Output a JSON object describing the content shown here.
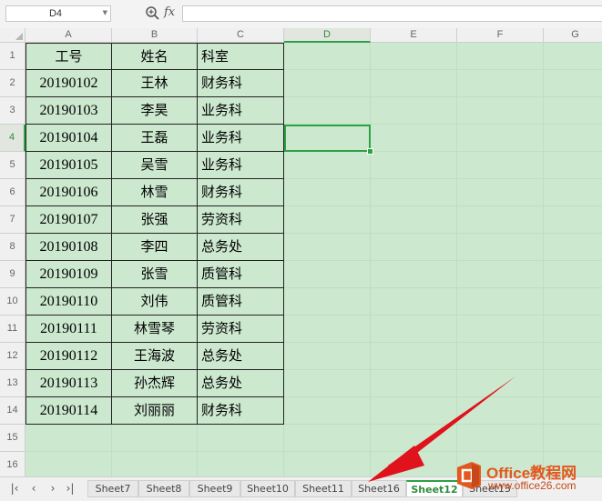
{
  "formula_bar": {
    "name_box": "D4",
    "fx_label": "fx",
    "formula": ""
  },
  "columns": [
    "A",
    "B",
    "C",
    "D",
    "E",
    "F",
    "G"
  ],
  "rows": [
    "1",
    "2",
    "3",
    "4",
    "5",
    "6",
    "7",
    "8",
    "9",
    "10",
    "11",
    "12",
    "13",
    "14",
    "15",
    "16"
  ],
  "selected_cell": "D4",
  "table": {
    "headers": [
      "工号",
      "姓名",
      "科室"
    ],
    "rows": [
      [
        "20190102",
        "王林",
        "财务科"
      ],
      [
        "20190103",
        "李昊",
        "业务科"
      ],
      [
        "20190104",
        "王磊",
        "业务科"
      ],
      [
        "20190105",
        "吴雪",
        "业务科"
      ],
      [
        "20190106",
        "林雪",
        "财务科"
      ],
      [
        "20190107",
        "张强",
        "劳资科"
      ],
      [
        "20190108",
        "李四",
        "总务处"
      ],
      [
        "20190109",
        "张雪",
        "质管科"
      ],
      [
        "20190110",
        "刘伟",
        "质管科"
      ],
      [
        "20190111",
        "林雪琴",
        "劳资科"
      ],
      [
        "20190112",
        "王海波",
        "总务处"
      ],
      [
        "20190113",
        "孙杰辉",
        "总务处"
      ],
      [
        "20190114",
        "刘丽丽",
        "财务科"
      ]
    ]
  },
  "sheet_nav": [
    "K",
    "<",
    ">",
    ">|"
  ],
  "sheet_tabs": [
    "Sheet7",
    "Sheet8",
    "Sheet9",
    "Sheet10",
    "Sheet11",
    "Sheet16",
    "Sheet12",
    "Sheet13"
  ],
  "active_sheet": "Sheet12",
  "watermark": {
    "brand": "Office教程网",
    "url": "www.office26.com"
  },
  "colors": {
    "cell_bg": "#cce8cf",
    "accent": "#2ba245",
    "arrow": "#e0121b",
    "watermark": "#e2581f"
  }
}
